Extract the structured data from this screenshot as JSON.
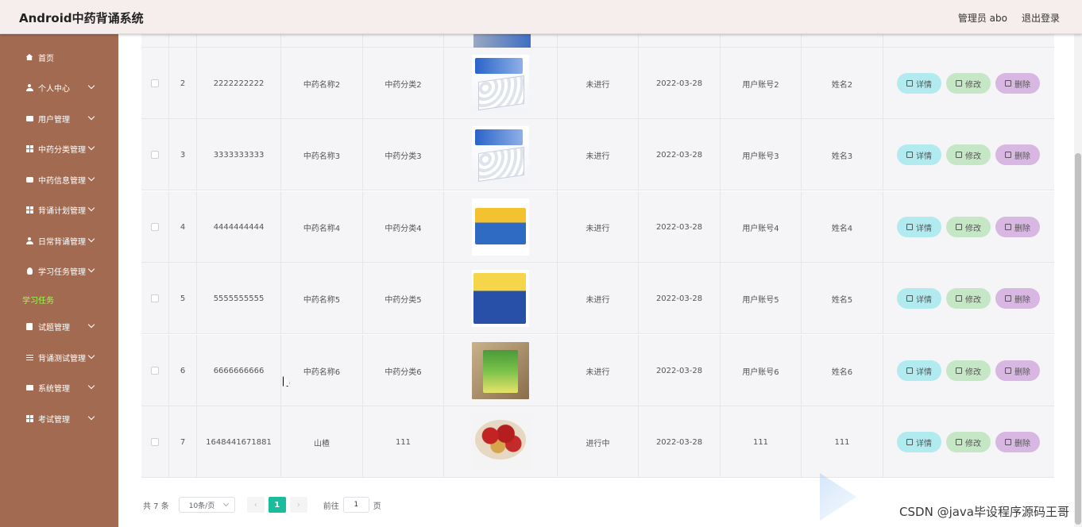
{
  "app": {
    "title": "Android中药背诵系统",
    "user_label": "管理员 abo",
    "logout_label": "退出登录"
  },
  "sidebar": {
    "items": [
      {
        "label": "首页",
        "icon": "home-icon",
        "has_arrow": false
      },
      {
        "label": "个人中心",
        "icon": "user-icon",
        "has_arrow": true
      },
      {
        "label": "用户管理",
        "icon": "chat-icon",
        "has_arrow": true
      },
      {
        "label": "中药分类管理",
        "icon": "grid-icon",
        "has_arrow": true
      },
      {
        "label": "中药信息管理",
        "icon": "message-icon",
        "has_arrow": true
      },
      {
        "label": "背诵计划管理",
        "icon": "grid-icon",
        "has_arrow": true
      },
      {
        "label": "日常背诵管理",
        "icon": "user-icon",
        "has_arrow": true
      },
      {
        "label": "学习任务管理",
        "icon": "bulb-icon",
        "has_arrow": true
      },
      {
        "label": "试题管理",
        "icon": "clipboard-icon",
        "has_arrow": true
      },
      {
        "label": "背诵测试管理",
        "icon": "slider-icon",
        "has_arrow": true
      },
      {
        "label": "系统管理",
        "icon": "briefcase-icon",
        "has_arrow": true
      },
      {
        "label": "考试管理",
        "icon": "grid-icon",
        "has_arrow": true
      }
    ],
    "active_sub": "学习任务"
  },
  "table": {
    "rows": [
      {
        "index": "2",
        "number": "2222222222",
        "name": "中药名称2",
        "category": "中药分类2",
        "image": "medicine-box",
        "status": "未进行",
        "date": "2022-03-28",
        "account": "用户账号2",
        "username": "姓名2"
      },
      {
        "index": "3",
        "number": "3333333333",
        "name": "中药名称3",
        "category": "中药分类3",
        "image": "medicine-box",
        "status": "未进行",
        "date": "2022-03-28",
        "account": "用户账号3",
        "username": "姓名3"
      },
      {
        "index": "4",
        "number": "4444444444",
        "name": "中药名称4",
        "category": "中药分类4",
        "image": "granule-box-yellow",
        "status": "未进行",
        "date": "2022-03-28",
        "account": "用户账号4",
        "username": "姓名4"
      },
      {
        "index": "5",
        "number": "5555555555",
        "name": "中药名称5",
        "category": "中药分类5",
        "image": "granule-box-blue",
        "status": "未进行",
        "date": "2022-03-28",
        "account": "用户账号5",
        "username": "姓名5"
      },
      {
        "index": "6",
        "number": "6666666666",
        "name": "中药名称6",
        "category": "中药分类6",
        "image": "herbal-box-green",
        "status": "未进行",
        "date": "2022-03-28",
        "account": "用户账号6",
        "username": "姓名6"
      },
      {
        "index": "7",
        "number": "1648441671881",
        "name": "山楂",
        "category": "111",
        "image": "hawthorn-slices",
        "status": "进行中",
        "date": "2022-03-28",
        "account": "111",
        "username": "111"
      }
    ],
    "actions": {
      "detail": "详情",
      "edit": "修改",
      "delete": "删除"
    }
  },
  "pagination": {
    "total_label": "共 7 条",
    "page_size": "10条/页",
    "prev": "‹",
    "current_page": "1",
    "next": "›",
    "goto_label": "前往",
    "goto_value": "1",
    "page_suffix": "页"
  },
  "watermark": "CSDN @java毕设程序源码王哥"
}
